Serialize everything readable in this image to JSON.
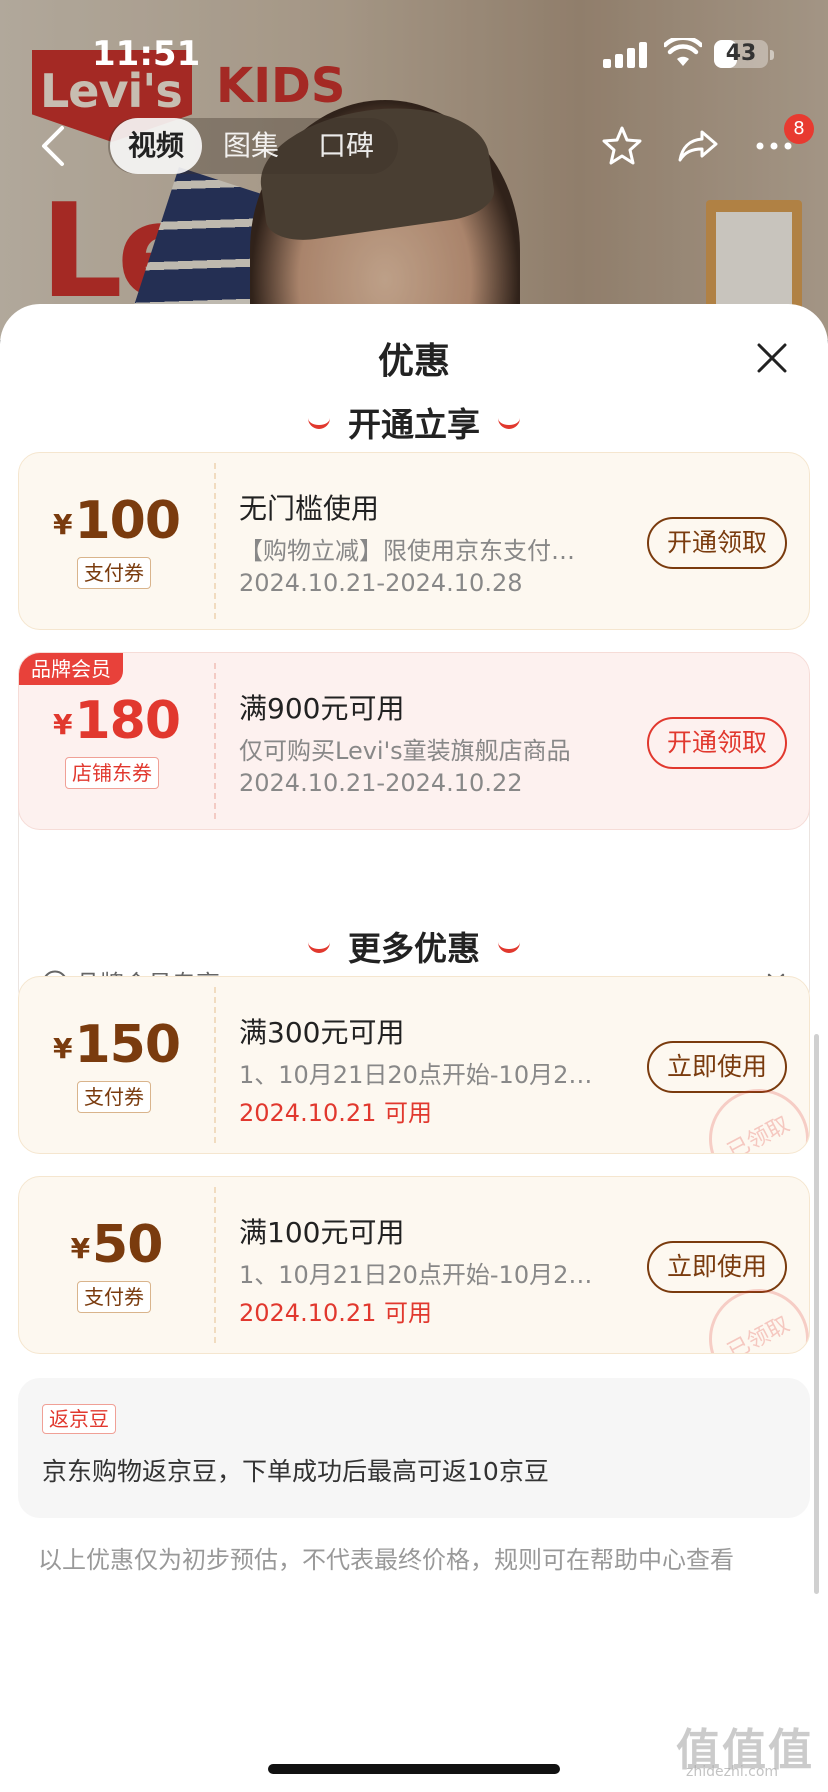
{
  "status_bar": {
    "time": "11:51",
    "battery_level": "43",
    "battery_fraction": 0.43
  },
  "background_photo": {
    "logo_text": "Levi's",
    "kids_text": "KIDS",
    "sign_text": "Lev"
  },
  "nav": {
    "tabs": [
      {
        "label": "视频",
        "active": true
      },
      {
        "label": "图集",
        "active": false
      },
      {
        "label": "口碑",
        "active": false
      }
    ],
    "badge_count": "8",
    "icons": [
      "back-icon",
      "star-icon",
      "share-icon",
      "more-icon"
    ]
  },
  "sheet": {
    "title": "优惠",
    "section_open": "开通立享",
    "section_more": "更多优惠",
    "coupons_open": [
      {
        "currency": "¥",
        "amount": "100",
        "type_tag": "支付券",
        "title": "无门槛使用",
        "description": "【购物立减】限使用京东支付…",
        "date": "2024.10.21-2024.10.28",
        "button": "开通领取"
      },
      {
        "ribbon": "品牌会员",
        "currency": "¥",
        "amount": "180",
        "type_tag": "店铺东券",
        "title": "满900元可用",
        "description": "仅可购买Levi's童装旗舰店商品",
        "date": "2024.10.21-2024.10.22",
        "button": "开通领取"
      }
    ],
    "member_exclusive_label": "品牌会员专享",
    "coupons_more": [
      {
        "currency": "¥",
        "amount": "150",
        "type_tag": "支付券",
        "title": "满300元可用",
        "description": "1、10月21日20点开始-10月2…",
        "date": "2024.10.21 可用",
        "button": "立即使用",
        "stamp": "已领取"
      },
      {
        "currency": "¥",
        "amount": "50",
        "type_tag": "支付券",
        "title": "满100元可用",
        "description": "1、10月21日20点开始-10月2…",
        "date": "2024.10.21 可用",
        "button": "立即使用",
        "stamp": "已领取"
      }
    ],
    "jd_beans": {
      "tag": "返京豆",
      "text": "京东购物返京豆，下单成功后最高可返10京豆"
    },
    "footnote": "以上优惠仅为初步预估，不代表最终价格，规则可在帮助中心查看"
  },
  "watermark": {
    "text": "值值值",
    "sub": "zhidezhi.com"
  },
  "colors": {
    "accent_red": "#e1382e",
    "coupon_brown": "#7a3b0e",
    "coupon_bg": "#fdf8f0",
    "brand_bg": "#fdf1ef"
  }
}
